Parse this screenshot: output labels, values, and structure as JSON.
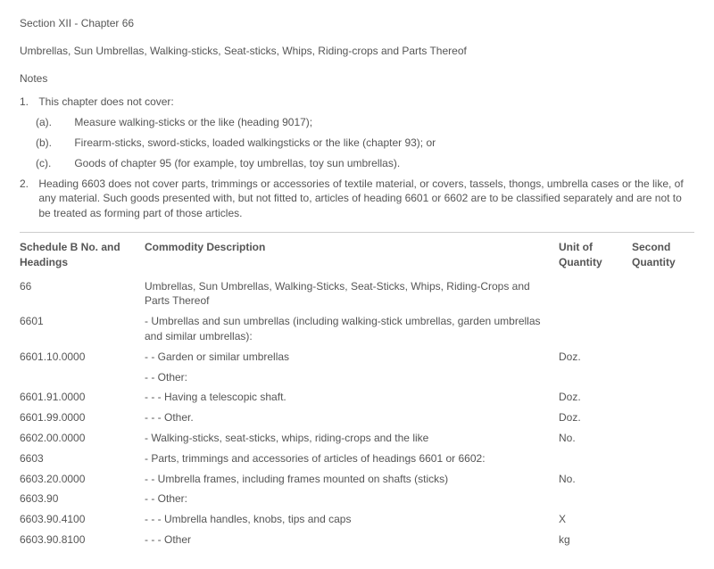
{
  "header": {
    "section_title": "Section XII - Chapter 66",
    "section_desc": "Umbrellas, Sun Umbrellas, Walking-sticks, Seat-sticks, Whips, Riding-crops and Parts Thereof",
    "notes_label": "Notes"
  },
  "notes": {
    "n1_num": "1.",
    "n1_text": "This chapter does not cover:",
    "n1a_label": "(a).",
    "n1a_text": "Measure walking-sticks or the like (heading 9017);",
    "n1b_label": "(b).",
    "n1b_text": "Firearm-sticks, sword-sticks, loaded walkingsticks or the like (chapter 93); or",
    "n1c_label": "(c).",
    "n1c_text": "Goods of chapter 95 (for example, toy umbrellas, toy sun umbrellas).",
    "n2_num": "2.",
    "n2_text": "Heading 6603 does not cover parts, trimmings or accessories of textile material, or covers, tassels, thongs, umbrella cases or the like, of any material. Such goods presented with, but not fitted to, articles of heading 6601 or 6602 are to be classified separately and are not to be treated as forming part of those articles."
  },
  "table": {
    "headers": {
      "code": "Schedule B No. and Headings",
      "desc": "Commodity Description",
      "unit": "Unit of Quantity",
      "second": "Second Quantity"
    },
    "rows": [
      {
        "code": "66",
        "desc": "Umbrellas, Sun Umbrellas, Walking-Sticks, Seat-Sticks, Whips, Riding-Crops and Parts Thereof",
        "unit": "",
        "second": ""
      },
      {
        "code": "6601",
        "desc": "- Umbrellas and sun umbrellas (including walking-stick umbrellas, garden umbrellas and similar umbrellas):",
        "unit": "",
        "second": ""
      },
      {
        "code": "6601.10.0000",
        "desc": "- - Garden or similar umbrellas",
        "unit": "Doz.",
        "second": ""
      },
      {
        "code": "",
        "desc": "- - Other:",
        "unit": "",
        "second": ""
      },
      {
        "code": "6601.91.0000",
        "desc": "- - - Having a telescopic shaft.",
        "unit": "Doz.",
        "second": ""
      },
      {
        "code": "6601.99.0000",
        "desc": "- - - Other.",
        "unit": "Doz.",
        "second": ""
      },
      {
        "code": "6602.00.0000",
        "desc": "- Walking-sticks, seat-sticks, whips, riding-crops and the like",
        "unit": "No.",
        "second": ""
      },
      {
        "code": "6603",
        "desc": "- Parts, trimmings and accessories of articles of headings 6601 or 6602:",
        "unit": "",
        "second": ""
      },
      {
        "code": "6603.20.0000",
        "desc": "- - Umbrella frames, including frames mounted on shafts (sticks)",
        "unit": "No.",
        "second": ""
      },
      {
        "code": "6603.90",
        "desc": "- - Other:",
        "unit": "",
        "second": ""
      },
      {
        "code": "6603.90.4100",
        "desc": "- - - Umbrella handles, knobs, tips and caps",
        "unit": "X",
        "second": ""
      },
      {
        "code": "6603.90.8100",
        "desc": "- - - Other",
        "unit": "kg",
        "second": ""
      }
    ]
  }
}
